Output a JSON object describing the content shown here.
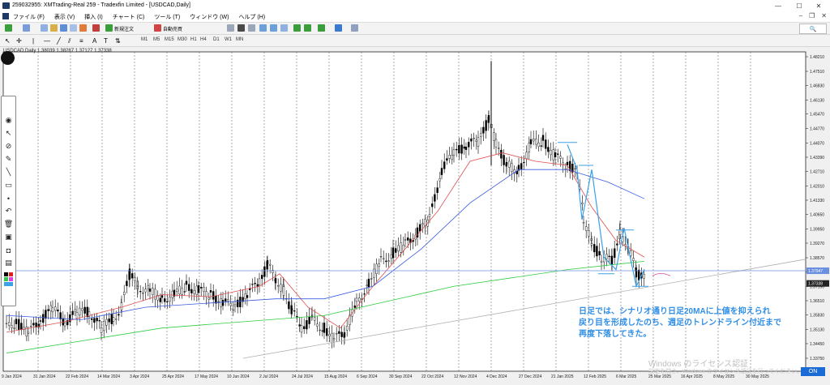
{
  "window": {
    "title": "259032955: XMTrading-Real 259 - Tradexfin Limited - [USDCAD,Daily]",
    "minimize": "—",
    "maximize": "☐",
    "close": "✕"
  },
  "menu": [
    "ファイル (F)",
    "表示 (V)",
    "挿入 (I)",
    "チャート (C)",
    "ツール (T)",
    "ウィンドウ (W)",
    "ヘルプ (H)"
  ],
  "toolbar": {
    "new_order": "新規注文",
    "auto_trade": "自動売買",
    "timeframes": [
      "M1",
      "M5",
      "M15",
      "M30",
      "H1",
      "H4",
      "D1",
      "W1",
      "MN"
    ],
    "search_icon": "search-icon"
  },
  "chart": {
    "symbol_info": "USDCAD,Daily  1.38039 1.38287 1.37127 1.37338",
    "price_labels": [
      "1.48210",
      "1.47510",
      "1.46830",
      "1.46130",
      "1.45470",
      "1.44770",
      "1.44070",
      "1.43390",
      "1.42710",
      "1.42010",
      "1.41330",
      "1.40650",
      "1.39950",
      "1.39270",
      "1.38570",
      "1.37890",
      "1.37190",
      "1.36510",
      "1.35830",
      "1.35130",
      "1.34450",
      "1.33750"
    ],
    "current_price_tag": "1.37338",
    "hline_price_tag": "1.37947",
    "date_labels": [
      "9 Jan 2024",
      "31 Jan 2024",
      "22 Feb 2024",
      "14 Mar 2024",
      "3 Apr 2024",
      "25 Apr 2024",
      "17 May 2024",
      "10 Jun 2024",
      "2 Jul 2024",
      "24 Jul 2024",
      "15 Aug 2024",
      "6 Sep 2024",
      "30 Sep 2024",
      "22 Oct 2024",
      "12 Nov 2024",
      "4 Dec 2024",
      "27 Dec 2024",
      "21 Jan 2025",
      "12 Feb 2025",
      "6 Mar 2025",
      "25 Mar 2025",
      "16 Apr 2025",
      "8 May 2025",
      "30 May 2025"
    ],
    "colors": {
      "bg": "#ffffff",
      "candle": "#000000",
      "ma20": "#e05050",
      "ma_mid": "#3a5be0",
      "ma_long": "#2ecc40",
      "trend": "#b0b0b0",
      "hline": "#6b8fe0",
      "zigzag": "#3aa0e8",
      "annot": "#2f8ee6"
    }
  },
  "annotation": "日足では、シナリオ通り日足20MAに上値を抑えられ\n戻り目を形成したのち、週足のトレンドライン付近まで\n再度下落してきた。",
  "watermark": "Windows のライセンス認証",
  "watermark_sub": "設定を開き、Windows のライセンス認証を行ってください。",
  "status_badge": "ON"
}
